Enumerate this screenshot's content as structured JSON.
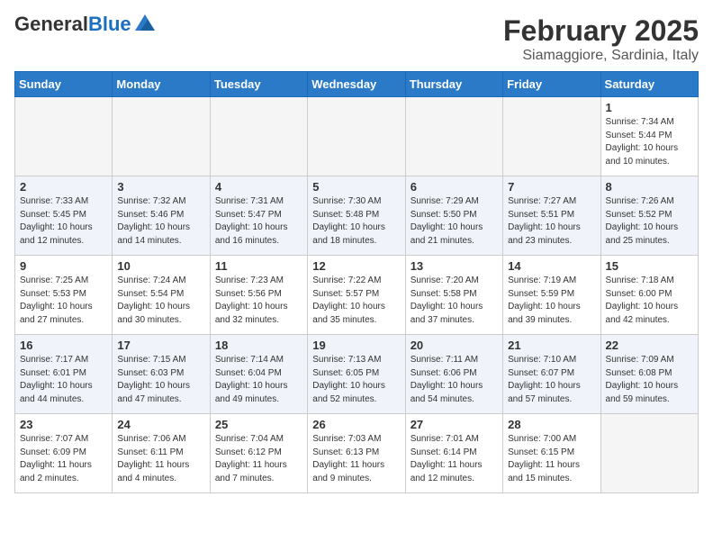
{
  "logo": {
    "general": "General",
    "blue": "Blue"
  },
  "title": "February 2025",
  "location": "Siamaggiore, Sardinia, Italy",
  "days_of_week": [
    "Sunday",
    "Monday",
    "Tuesday",
    "Wednesday",
    "Thursday",
    "Friday",
    "Saturday"
  ],
  "weeks": [
    [
      {
        "day": null,
        "info": null
      },
      {
        "day": null,
        "info": null
      },
      {
        "day": null,
        "info": null
      },
      {
        "day": null,
        "info": null
      },
      {
        "day": null,
        "info": null
      },
      {
        "day": null,
        "info": null
      },
      {
        "day": "1",
        "info": "Sunrise: 7:34 AM\nSunset: 5:44 PM\nDaylight: 10 hours\nand 10 minutes."
      }
    ],
    [
      {
        "day": "2",
        "info": "Sunrise: 7:33 AM\nSunset: 5:45 PM\nDaylight: 10 hours\nand 12 minutes."
      },
      {
        "day": "3",
        "info": "Sunrise: 7:32 AM\nSunset: 5:46 PM\nDaylight: 10 hours\nand 14 minutes."
      },
      {
        "day": "4",
        "info": "Sunrise: 7:31 AM\nSunset: 5:47 PM\nDaylight: 10 hours\nand 16 minutes."
      },
      {
        "day": "5",
        "info": "Sunrise: 7:30 AM\nSunset: 5:48 PM\nDaylight: 10 hours\nand 18 minutes."
      },
      {
        "day": "6",
        "info": "Sunrise: 7:29 AM\nSunset: 5:50 PM\nDaylight: 10 hours\nand 21 minutes."
      },
      {
        "day": "7",
        "info": "Sunrise: 7:27 AM\nSunset: 5:51 PM\nDaylight: 10 hours\nand 23 minutes."
      },
      {
        "day": "8",
        "info": "Sunrise: 7:26 AM\nSunset: 5:52 PM\nDaylight: 10 hours\nand 25 minutes."
      }
    ],
    [
      {
        "day": "9",
        "info": "Sunrise: 7:25 AM\nSunset: 5:53 PM\nDaylight: 10 hours\nand 27 minutes."
      },
      {
        "day": "10",
        "info": "Sunrise: 7:24 AM\nSunset: 5:54 PM\nDaylight: 10 hours\nand 30 minutes."
      },
      {
        "day": "11",
        "info": "Sunrise: 7:23 AM\nSunset: 5:56 PM\nDaylight: 10 hours\nand 32 minutes."
      },
      {
        "day": "12",
        "info": "Sunrise: 7:22 AM\nSunset: 5:57 PM\nDaylight: 10 hours\nand 35 minutes."
      },
      {
        "day": "13",
        "info": "Sunrise: 7:20 AM\nSunset: 5:58 PM\nDaylight: 10 hours\nand 37 minutes."
      },
      {
        "day": "14",
        "info": "Sunrise: 7:19 AM\nSunset: 5:59 PM\nDaylight: 10 hours\nand 39 minutes."
      },
      {
        "day": "15",
        "info": "Sunrise: 7:18 AM\nSunset: 6:00 PM\nDaylight: 10 hours\nand 42 minutes."
      }
    ],
    [
      {
        "day": "16",
        "info": "Sunrise: 7:17 AM\nSunset: 6:01 PM\nDaylight: 10 hours\nand 44 minutes."
      },
      {
        "day": "17",
        "info": "Sunrise: 7:15 AM\nSunset: 6:03 PM\nDaylight: 10 hours\nand 47 minutes."
      },
      {
        "day": "18",
        "info": "Sunrise: 7:14 AM\nSunset: 6:04 PM\nDaylight: 10 hours\nand 49 minutes."
      },
      {
        "day": "19",
        "info": "Sunrise: 7:13 AM\nSunset: 6:05 PM\nDaylight: 10 hours\nand 52 minutes."
      },
      {
        "day": "20",
        "info": "Sunrise: 7:11 AM\nSunset: 6:06 PM\nDaylight: 10 hours\nand 54 minutes."
      },
      {
        "day": "21",
        "info": "Sunrise: 7:10 AM\nSunset: 6:07 PM\nDaylight: 10 hours\nand 57 minutes."
      },
      {
        "day": "22",
        "info": "Sunrise: 7:09 AM\nSunset: 6:08 PM\nDaylight: 10 hours\nand 59 minutes."
      }
    ],
    [
      {
        "day": "23",
        "info": "Sunrise: 7:07 AM\nSunset: 6:09 PM\nDaylight: 11 hours\nand 2 minutes."
      },
      {
        "day": "24",
        "info": "Sunrise: 7:06 AM\nSunset: 6:11 PM\nDaylight: 11 hours\nand 4 minutes."
      },
      {
        "day": "25",
        "info": "Sunrise: 7:04 AM\nSunset: 6:12 PM\nDaylight: 11 hours\nand 7 minutes."
      },
      {
        "day": "26",
        "info": "Sunrise: 7:03 AM\nSunset: 6:13 PM\nDaylight: 11 hours\nand 9 minutes."
      },
      {
        "day": "27",
        "info": "Sunrise: 7:01 AM\nSunset: 6:14 PM\nDaylight: 11 hours\nand 12 minutes."
      },
      {
        "day": "28",
        "info": "Sunrise: 7:00 AM\nSunset: 6:15 PM\nDaylight: 11 hours\nand 15 minutes."
      },
      {
        "day": null,
        "info": null
      }
    ]
  ]
}
